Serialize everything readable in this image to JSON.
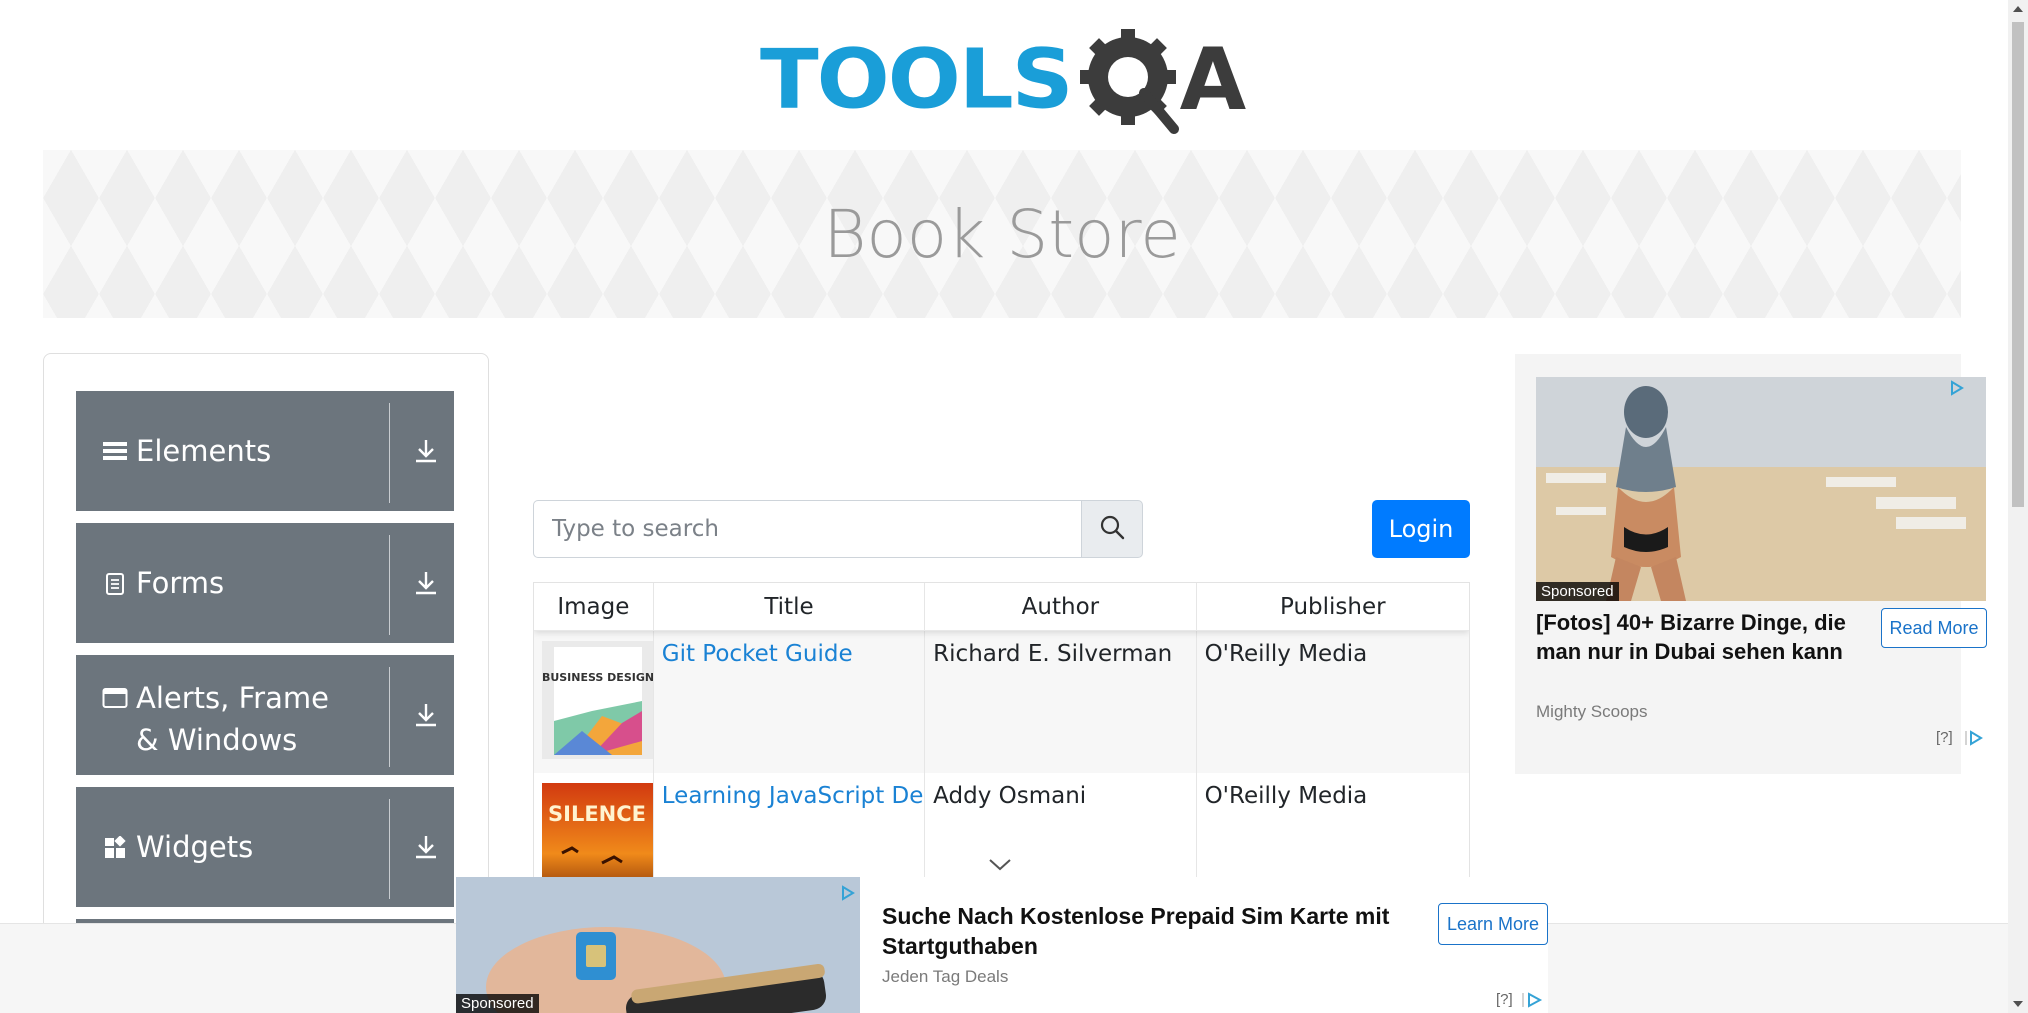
{
  "logo": {
    "part1": "TOOLS",
    "part2": "A"
  },
  "banner": {
    "title": "Book Store"
  },
  "sidebar": {
    "groups": [
      {
        "label": "Elements",
        "icon": "hamburger-icon"
      },
      {
        "label": "Forms",
        "icon": "document-icon"
      },
      {
        "label": "Alerts, Frame & Windows",
        "icon": "window-icon"
      },
      {
        "label": "Widgets",
        "icon": "widgets-icon"
      }
    ]
  },
  "search": {
    "placeholder": "Type to search",
    "value": ""
  },
  "login": {
    "label": "Login"
  },
  "table": {
    "headers": [
      "Image",
      "Title",
      "Author",
      "Publisher"
    ],
    "rows": [
      {
        "title": "Git Pocket Guide",
        "author": "Richard E. Silverman",
        "publisher": "O'Reilly Media",
        "thumb_text": "BUSINESS DESIGN"
      },
      {
        "title": "Learning JavaScript Design Patterns",
        "author": "Addy Osmani",
        "publisher": "O'Reilly Media",
        "thumb_text": "SILENCE"
      }
    ]
  },
  "right_ad": {
    "sponsored": "Sponsored",
    "title": "[Fotos] 40+ Bizarre Dinge, die man nur in Dubai sehen kann",
    "source": "Mighty Scoops",
    "button": "Read More",
    "help": "[?]"
  },
  "bottom_ad": {
    "sponsored": "Sponsored",
    "title": "Suche Nach Kostenlose Prepaid Sim Karte mit Startguthaben",
    "source": "Jeden Tag Deals",
    "button": "Learn More",
    "help": "[?]"
  },
  "colors": {
    "primary": "#007bff",
    "nav_bg": "#6c757d",
    "link": "#1a82d4",
    "logo_blue": "#1a9ed8"
  }
}
